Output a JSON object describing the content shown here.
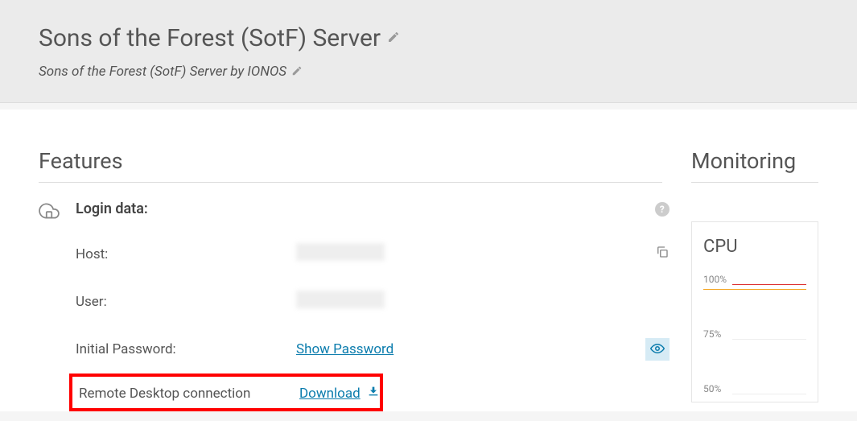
{
  "header": {
    "title": "Sons of the Forest (SotF) Server",
    "subtitle": "Sons of the Forest (SotF) Server by IONOS"
  },
  "features": {
    "heading": "Features",
    "login": {
      "heading": "Login data:",
      "rows": {
        "host_label": "Host:",
        "user_label": "User:",
        "initial_password_label": "Initial Password:",
        "show_password_link": "Show Password",
        "rdp_label": "Remote Desktop connection",
        "download_link": "Download"
      }
    }
  },
  "monitoring": {
    "heading": "Monitoring",
    "cpu": {
      "title": "CPU",
      "ticks": [
        "100%",
        "75%",
        "50%"
      ]
    }
  }
}
